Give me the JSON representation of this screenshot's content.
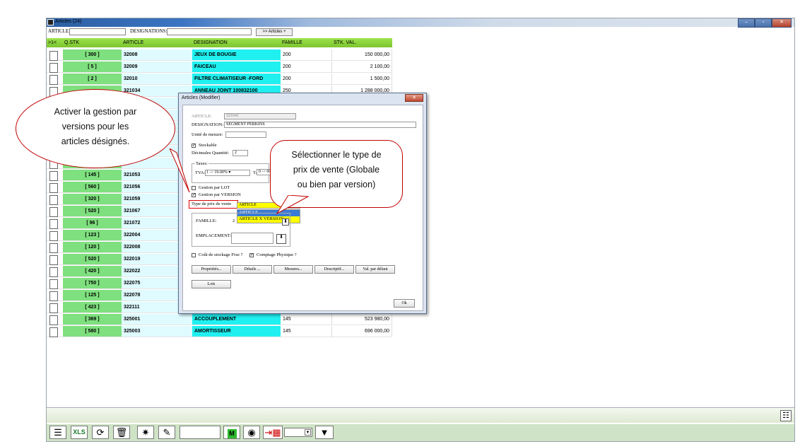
{
  "window": {
    "title": "Articles (24)",
    "controls": [
      "–",
      "▫",
      "✕"
    ]
  },
  "filters": {
    "article_label": "ARTICLE:",
    "designations_label": "DESIGNATIONS:",
    "articles_button": ">> Articles +"
  },
  "grid": {
    "headers": [
      ">1<",
      "Q.STK",
      "ARTICLE",
      "DESIGNATION",
      "FAMILLE",
      "STK. VAL."
    ],
    "rows": [
      {
        "qstk": "[ 300 ]",
        "article": "32008",
        "designation": "JEUX DE BOUGIE",
        "famille": "200",
        "stk_val": "150 000,00"
      },
      {
        "qstk": "[ 5 ]",
        "article": "32009",
        "designation": "FAICEAU",
        "famille": "200",
        "stk_val": "2 100,00"
      },
      {
        "qstk": "[ 2 ]",
        "article": "32010",
        "designation": "FILTRE CLIMATISEUR -FORD",
        "famille": "200",
        "stk_val": "1 500,00"
      },
      {
        "qstk": "",
        "article": "321034",
        "designation": "ANNEAU JOINT 100832100",
        "famille": "250",
        "stk_val": "1 288 000,00"
      },
      {
        "qstk": "",
        "article": "",
        "designation": "",
        "famille": "",
        "stk_val": ""
      },
      {
        "qstk": "",
        "article": "",
        "designation": "",
        "famille": "",
        "stk_val": ""
      },
      {
        "qstk": "",
        "article": "",
        "designation": "",
        "famille": "",
        "stk_val": ""
      },
      {
        "qstk": "",
        "article": "",
        "designation": "",
        "famille": "",
        "stk_val": ""
      },
      {
        "qstk": "",
        "article": "",
        "designation": "",
        "famille": "",
        "stk_val": ""
      },
      {
        "qstk": "",
        "article": "",
        "designation": "",
        "famille": "",
        "stk_val": ""
      },
      {
        "qstk": "[ 145 ]",
        "article": "321053",
        "designation": "",
        "famille": "",
        "stk_val": ""
      },
      {
        "qstk": "[ 560 ]",
        "article": "321056",
        "designation": "",
        "famille": "",
        "stk_val": ""
      },
      {
        "qstk": "[ 320 ]",
        "article": "321059",
        "designation": "",
        "famille": "",
        "stk_val": ""
      },
      {
        "qstk": "[ 520 ]",
        "article": "321067",
        "designation": "",
        "famille": "",
        "stk_val": ""
      },
      {
        "qstk": "[ 96 ]",
        "article": "321072",
        "designation": "",
        "famille": "",
        "stk_val": ""
      },
      {
        "qstk": "[ 123 ]",
        "article": "322004",
        "designation": "",
        "famille": "",
        "stk_val": ""
      },
      {
        "qstk": "[ 120 ]",
        "article": "322008",
        "designation": "",
        "famille": "",
        "stk_val": ""
      },
      {
        "qstk": "[ 520 ]",
        "article": "322019",
        "designation": "",
        "famille": "",
        "stk_val": ""
      },
      {
        "qstk": "[ 420 ]",
        "article": "322022",
        "designation": "",
        "famille": "",
        "stk_val": ""
      },
      {
        "qstk": "[ 750 ]",
        "article": "322075",
        "designation": "",
        "famille": "",
        "stk_val": ""
      },
      {
        "qstk": "[ 125 ]",
        "article": "322078",
        "designation": "",
        "famille": "",
        "stk_val": ""
      },
      {
        "qstk": "[ 423 ]",
        "article": "322111",
        "designation": "",
        "famille": "",
        "stk_val": ""
      },
      {
        "qstk": "[ 369 ]",
        "article": "325001",
        "designation": "ACCOUPLEMENT",
        "famille": "145",
        "stk_val": "523 980,00"
      },
      {
        "qstk": "[ 580 ]",
        "article": "325003",
        "designation": "AMORTISSEUR",
        "famille": "145",
        "stk_val": "696 000,00"
      }
    ]
  },
  "dialog": {
    "title": "Articles  (Modifier)",
    "close": "✕",
    "article_label": "ARTICLE:",
    "article_value": "321041",
    "designation_label": "DESIGNATION:",
    "designation_value": "SEGMENT PERKINS",
    "unite_label": "Unité de mesure:",
    "stockable_label": "Stockable",
    "decimales_label": "Décimales Quantité:",
    "decimales_value": "2",
    "taxes_label": "Taxes:",
    "tva_label": "TVA:",
    "tva_value": "1 -> 19.00%",
    "tap_label": "TAP:",
    "tap_value": "0 -> 00",
    "gestion_lot_label": "Gestion par LOT",
    "gestion_version_label": "Gestion par VERSION",
    "type_prix_label": "Type de prix de vente",
    "type_prix_value": "ARTICLE",
    "options": [
      "ARTICLE",
      "ARTICLE X VERSION"
    ],
    "famille_label": "FAMILLE:",
    "famille_value": "2",
    "emplacement_label": "EMPLACEMENT:",
    "cout_label": "Coût de stockage Fixe ?",
    "comptage_label": "Comptage Physique ?",
    "buttons": [
      "Propriétés...",
      "Détails ...",
      "Mesures...",
      "Descriptif...",
      "Val. par défaut"
    ],
    "lots_button": "Lots",
    "ok_button": "Ok"
  },
  "callouts": {
    "left": [
      "Activer la gestion par",
      "versions pour les",
      "articles désignés."
    ],
    "right": [
      "Sélectionner le type de",
      "prix de vente (Globale",
      "ou bien par version)"
    ]
  },
  "toolbar": {
    "icons": [
      "menu-icon",
      "excel-icon",
      "refresh-icon",
      "delete-icon",
      "sparkle-icon",
      "edit-icon",
      "m-icon",
      "eye-icon",
      "import-icon",
      "filter-icon"
    ],
    "m_label": "M"
  }
}
